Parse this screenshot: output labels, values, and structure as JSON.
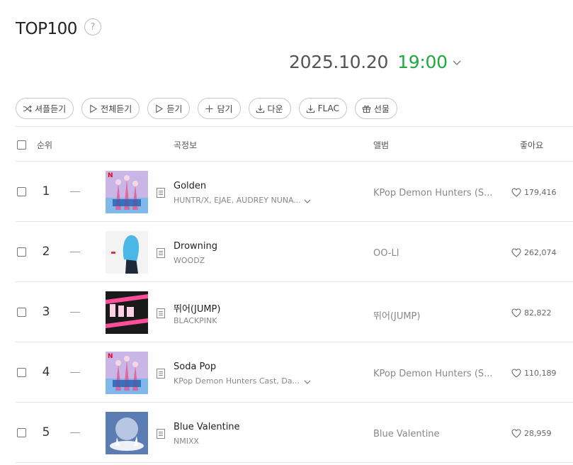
{
  "header": {
    "title": "TOP100",
    "help_glyph": "?",
    "date": "2025.10.20",
    "time": "19:00"
  },
  "toolbar": {
    "buttons": [
      {
        "label": "셔플듣기",
        "icon": "shuffle-icon"
      },
      {
        "label": "전체듣기",
        "icon": "play-icon"
      },
      {
        "label": "듣기",
        "icon": "play-icon"
      },
      {
        "label": "담기",
        "icon": "plus-icon"
      },
      {
        "label": "다운",
        "icon": "download-icon"
      },
      {
        "label": "FLAC",
        "icon": "download-icon"
      },
      {
        "label": "선물",
        "icon": "gift-icon"
      }
    ]
  },
  "table": {
    "headers": {
      "rank": "순위",
      "song_info": "곡정보",
      "album": "앨범",
      "likes": "좋아요"
    },
    "rows": [
      {
        "rank": "1",
        "title": "Golden",
        "artist": "HUNTR/X, EJAE, AUDREY NUNA...",
        "album": "KPop Demon Hunters (S...",
        "likes": "179,416",
        "has_artist_dropdown": true,
        "cover_colors": [
          "#c9b6e6",
          "#7fb8ea",
          "#e35a93"
        ]
      },
      {
        "rank": "2",
        "title": "Drowning",
        "artist": "WOODZ",
        "album": "OO-LI",
        "likes": "262,074",
        "has_artist_dropdown": false,
        "cover_colors": [
          "#f3f3f3",
          "#4ab8e6",
          "#1d2a3a"
        ]
      },
      {
        "rank": "3",
        "title": "뛰어(JUMP)",
        "artist": "BLACKPINK",
        "album": "뛰어(JUMP)",
        "likes": "82,822",
        "has_artist_dropdown": false,
        "cover_colors": [
          "#1a1a1a",
          "#ff4f9a",
          "#ffd1e3"
        ]
      },
      {
        "rank": "4",
        "title": "Soda Pop",
        "artist": "KPop Demon Hunters Cast, Da...",
        "album": "KPop Demon Hunters (S...",
        "likes": "110,189",
        "has_artist_dropdown": true,
        "cover_colors": [
          "#c9b6e6",
          "#7fb8ea",
          "#e35a93"
        ]
      },
      {
        "rank": "5",
        "title": "Blue Valentine",
        "artist": "NMIXX",
        "album": "Blue Valentine",
        "likes": "28,959",
        "has_artist_dropdown": false,
        "cover_colors": [
          "#5c7db3",
          "#b7c7e2",
          "#eef2f8"
        ]
      }
    ]
  },
  "colors": {
    "accent_green": "#1daa3f",
    "netflix_red": "#e50914"
  }
}
